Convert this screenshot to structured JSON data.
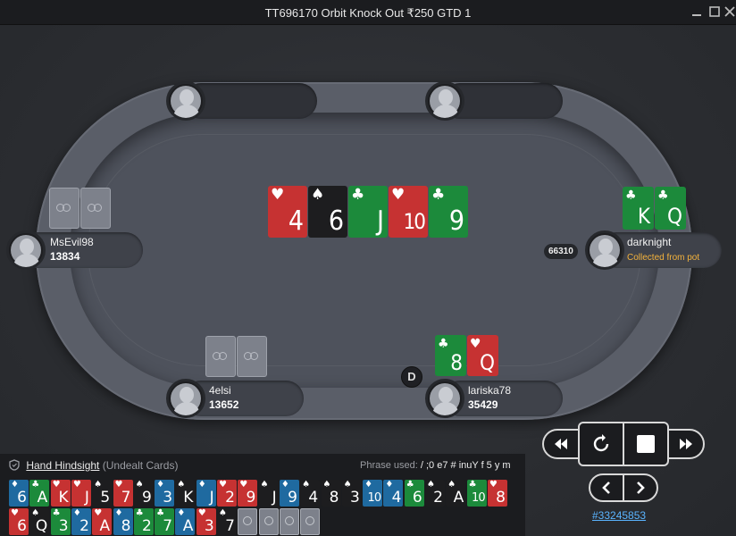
{
  "window": {
    "title": "TT696170 Orbit Knock Out ₹250 GTD 1",
    "minimize_icon": "minimize-icon",
    "maximize_icon": "maximize-icon",
    "close_icon": "close-icon"
  },
  "board": [
    {
      "rank": "4",
      "suit": "♥",
      "color": "red"
    },
    {
      "rank": "6",
      "suit": "♠",
      "color": "blk"
    },
    {
      "rank": "J",
      "suit": "♣",
      "color": "grn"
    },
    {
      "rank": "10",
      "suit": "♥",
      "color": "red"
    },
    {
      "rank": "9",
      "suit": "♣",
      "color": "grn"
    }
  ],
  "players": {
    "msevil": {
      "name": "MsEvil98",
      "stack": "13834"
    },
    "darknight": {
      "name": "darknight",
      "status": "Collected from pot",
      "cards": [
        {
          "rank": "K",
          "suit": "♣",
          "color": "grn"
        },
        {
          "rank": "Q",
          "suit": "♣",
          "color": "grn"
        }
      ]
    },
    "4elsi": {
      "name": "4elsi",
      "stack": "13652"
    },
    "lariska": {
      "name": "lariska78",
      "stack": "35429",
      "cards": [
        {
          "rank": "8",
          "suit": "♣",
          "color": "grn"
        },
        {
          "rank": "Q",
          "suit": "♥",
          "color": "red"
        }
      ]
    }
  },
  "pot": "66310",
  "dealer_button": "D",
  "controls": {
    "rewind_icon": "rewind-icon",
    "replay_icon": "replay-icon",
    "stop_icon": "stop-icon",
    "fast_forward_icon": "fast-forward-icon",
    "prev_icon": "chevron-left-icon",
    "next_icon": "chevron-right-icon",
    "hand_id": "#33245853"
  },
  "hindsight": {
    "shield_icon": "shield-icon",
    "title": "Hand Hindsight",
    "subtitle": "(Undealt Cards)",
    "phrase_label": "Phrase used:",
    "phrase_value": "/ ;0 e7 # inuY f 5 y m",
    "row1": [
      {
        "r": "6",
        "s": "♦",
        "c": "blu"
      },
      {
        "r": "A",
        "s": "♣",
        "c": "grn"
      },
      {
        "r": "K",
        "s": "♥",
        "c": "red"
      },
      {
        "r": "J",
        "s": "♥",
        "c": "red"
      },
      {
        "r": "5",
        "s": "♠",
        "c": "blk"
      },
      {
        "r": "7",
        "s": "♥",
        "c": "red"
      },
      {
        "r": "9",
        "s": "♠",
        "c": "blk"
      },
      {
        "r": "3",
        "s": "♦",
        "c": "blu"
      },
      {
        "r": "K",
        "s": "♠",
        "c": "blk"
      },
      {
        "r": "J",
        "s": "♦",
        "c": "blu"
      },
      {
        "r": "2",
        "s": "♥",
        "c": "red"
      },
      {
        "r": "9",
        "s": "♥",
        "c": "red"
      },
      {
        "r": "J",
        "s": "♠",
        "c": "blk"
      },
      {
        "r": "9",
        "s": "♦",
        "c": "blu"
      },
      {
        "r": "4",
        "s": "♠",
        "c": "blk"
      },
      {
        "r": "8",
        "s": "♠",
        "c": "blk"
      },
      {
        "r": "3",
        "s": "♠",
        "c": "blk"
      },
      {
        "r": "10",
        "s": "♦",
        "c": "blu"
      },
      {
        "r": "4",
        "s": "♦",
        "c": "blu"
      },
      {
        "r": "6",
        "s": "♣",
        "c": "grn"
      },
      {
        "r": "2",
        "s": "♠",
        "c": "blk"
      },
      {
        "r": "A",
        "s": "♠",
        "c": "blk"
      },
      {
        "r": "10",
        "s": "♣",
        "c": "grn"
      },
      {
        "r": "8",
        "s": "♥",
        "c": "red"
      }
    ],
    "row2": [
      {
        "r": "6",
        "s": "♥",
        "c": "red"
      },
      {
        "r": "Q",
        "s": "♠",
        "c": "blk"
      },
      {
        "r": "3",
        "s": "♣",
        "c": "grn"
      },
      {
        "r": "2",
        "s": "♦",
        "c": "blu"
      },
      {
        "r": "A",
        "s": "♥",
        "c": "red"
      },
      {
        "r": "8",
        "s": "♦",
        "c": "blu"
      },
      {
        "r": "2",
        "s": "♣",
        "c": "grn"
      },
      {
        "r": "7",
        "s": "♣",
        "c": "grn"
      },
      {
        "r": "A",
        "s": "♦",
        "c": "blu"
      },
      {
        "r": "3",
        "s": "♥",
        "c": "red"
      },
      {
        "r": "7",
        "s": "♠",
        "c": "blk"
      },
      {
        "r": "",
        "s": "",
        "c": "back"
      },
      {
        "r": "",
        "s": "",
        "c": "back"
      },
      {
        "r": "",
        "s": "",
        "c": "back"
      },
      {
        "r": "",
        "s": "",
        "c": "back"
      }
    ]
  }
}
